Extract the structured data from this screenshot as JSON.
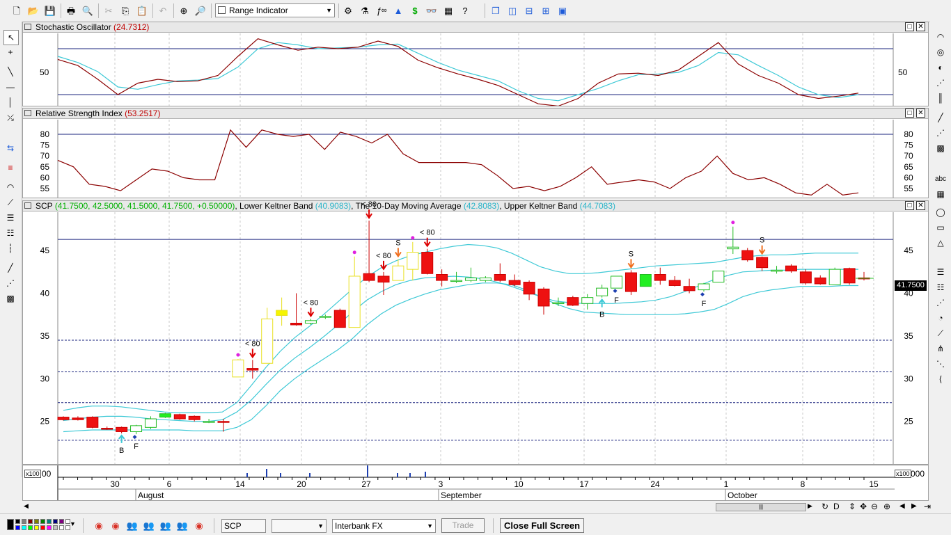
{
  "toolbar": {
    "indicator_select": "Range Indicator",
    "icons": [
      "new-file",
      "open-folder",
      "save",
      "print",
      "print-preview",
      "cut",
      "copy",
      "paste",
      "undo",
      "crosshair",
      "zoom",
      "object-properties",
      "indicator-builder",
      "formula",
      "trend",
      "dollar",
      "binoculars",
      "chart-properties",
      "help",
      "cascade",
      "tile-vertical",
      "tile-horizontal",
      "tile-grid",
      "screenshot"
    ]
  },
  "panels": {
    "stochastic": {
      "title": "Stochastic Oscillator",
      "value": "(24.7312)",
      "ticks": [
        "50"
      ]
    },
    "rsi": {
      "title": "Relative Strength Index",
      "value": "(53.2517)",
      "ticks": [
        "80",
        "75",
        "70",
        "65",
        "60",
        "55"
      ]
    },
    "price": {
      "symbol": "SCP",
      "quote": "(41.7500, 42.5000, 41.5000, 41.7500, +0.50000)",
      "lower_label": "Lower Keltner Band",
      "lower_value": "(40.9083)",
      "ma_label": "The 10-Day Moving Average",
      "ma_value": "(42.8083)",
      "upper_label": "Upper Keltner Band",
      "upper_value": "(44.7083)",
      "ticks": [
        "45",
        "40",
        "35",
        "30",
        "25"
      ],
      "last_price": "41.7500"
    }
  },
  "volume": {
    "multiplier": "x100",
    "zero": "00",
    "zero_right": "000"
  },
  "xaxis": {
    "day_labels": [
      "30",
      "6",
      "14",
      "20",
      "27",
      "3",
      "10",
      "17",
      "24",
      "1",
      "8",
      "15"
    ],
    "month_labels": [
      "August",
      "September",
      "October"
    ]
  },
  "signals": {
    "lt80": "< 80",
    "sell": "S",
    "buy": "B",
    "flat": "F"
  },
  "statusbar": {
    "symbol_input": "SCP",
    "period_select": "",
    "feed_select": "Interbank FX",
    "trade_button": "Trade",
    "fullscreen_button": "Close Full Screen"
  },
  "chart_data": [
    {
      "type": "line",
      "title": "Stochastic Oscillator",
      "ylim": [
        0,
        100
      ],
      "reference_lines": [
        80,
        20
      ],
      "series": [
        {
          "name": "%K",
          "color": "#8b0000",
          "values": [
            66,
            58,
            40,
            20,
            35,
            40,
            37,
            38,
            45,
            70,
            93,
            85,
            78,
            82,
            80,
            82,
            90,
            83,
            65,
            55,
            47,
            40,
            32,
            20,
            8,
            5,
            15,
            35,
            47,
            48,
            45,
            52,
            70,
            88,
            60,
            45,
            35,
            20,
            15,
            18,
            22
          ]
        },
        {
          "name": "%D",
          "color": "#3ec9d6",
          "values": [
            70,
            62,
            50,
            30,
            27,
            33,
            38,
            39,
            41,
            56,
            80,
            88,
            85,
            80,
            81,
            82,
            85,
            86,
            74,
            62,
            52,
            45,
            38,
            25,
            15,
            12,
            20,
            28,
            38,
            46,
            47,
            49,
            58,
            75,
            72,
            58,
            45,
            30,
            20,
            16,
            20
          ]
        }
      ]
    },
    {
      "type": "line",
      "title": "Relative Strength Index",
      "ylim": [
        50,
        85
      ],
      "reference_lines": [
        80,
        50
      ],
      "series": [
        {
          "name": "RSI",
          "color": "#8b0000",
          "values": [
            68,
            65,
            57,
            56,
            54,
            59,
            64,
            63,
            60,
            59,
            59,
            82,
            74,
            82,
            80,
            79,
            80,
            73,
            81,
            79,
            76,
            80,
            71,
            67,
            67,
            67,
            67,
            66,
            61,
            55,
            56,
            54,
            56,
            60,
            65,
            57,
            58,
            59,
            58,
            55,
            60,
            63,
            70,
            62,
            59,
            60,
            57,
            53,
            52,
            57,
            52,
            53
          ]
        }
      ]
    },
    {
      "type": "bar",
      "title": "SCP",
      "ylim": [
        22,
        49
      ],
      "reference_lines": [
        46.3,
        34.5,
        30.8,
        27.2,
        22.8
      ],
      "x": [
        "2018-07-26",
        "2018-07-27",
        "2018-07-30",
        "2018-07-31",
        "2018-08-01",
        "2018-08-02",
        "2018-08-03",
        "2018-08-06",
        "2018-08-07",
        "2018-08-08",
        "2018-08-09",
        "2018-08-10",
        "2018-08-13",
        "2018-08-14",
        "2018-08-15",
        "2018-08-16",
        "2018-08-17",
        "2018-08-20",
        "2018-08-21",
        "2018-08-22",
        "2018-08-23",
        "2018-08-24",
        "2018-08-27",
        "2018-08-28",
        "2018-08-29",
        "2018-08-30",
        "2018-08-31",
        "2018-09-03",
        "2018-09-04",
        "2018-09-05",
        "2018-09-06",
        "2018-09-07",
        "2018-09-10",
        "2018-09-11",
        "2018-09-12",
        "2018-09-13",
        "2018-09-14",
        "2018-09-17",
        "2018-09-18",
        "2018-09-19",
        "2018-09-20",
        "2018-09-21",
        "2018-09-24",
        "2018-09-25",
        "2018-09-26",
        "2018-09-27",
        "2018-09-28",
        "2018-10-01",
        "2018-10-02",
        "2018-10-03",
        "2018-10-04",
        "2018-10-05",
        "2018-10-08",
        "2018-10-09",
        "2018-10-10",
        "2018-10-11"
      ],
      "series": [
        {
          "name": "candles",
          "ohlc": [
            [
              25.5,
              25.6,
              25.1,
              25.2
            ],
            [
              25.4,
              25.6,
              25.1,
              25.2
            ],
            [
              25.5,
              25.6,
              24.2,
              24.3
            ],
            [
              24.2,
              24.4,
              24.0,
              24.1
            ],
            [
              24.3,
              24.4,
              23.6,
              23.8
            ],
            [
              23.8,
              24.6,
              23.5,
              24.5
            ],
            [
              24.3,
              25.6,
              24.1,
              25.3
            ],
            [
              25.5,
              26.0,
              25.4,
              25.9
            ],
            [
              25.8,
              25.9,
              25.2,
              25.3
            ],
            [
              25.6,
              25.7,
              25.0,
              25.2
            ],
            [
              25.0,
              25.3,
              24.8,
              25.0
            ],
            [
              25.0,
              25.3,
              23.8,
              24.9
            ],
            [
              30.2,
              32.3,
              30.2,
              32.2
            ],
            [
              31.2,
              32.2,
              30.0,
              31.0
            ],
            [
              31.8,
              38.3,
              31.8,
              37.0
            ],
            [
              37.4,
              39.5,
              36.2,
              38.0
            ],
            [
              36.5,
              40.0,
              36.2,
              36.3
            ],
            [
              36.5,
              37.0,
              36.3,
              36.8
            ],
            [
              37.2,
              37.5,
              37.0,
              37.3
            ],
            [
              38.0,
              38.2,
              36.0,
              36.0
            ],
            [
              36.0,
              44.3,
              36.0,
              42.0
            ],
            [
              42.3,
              48.5,
              41.3,
              41.5
            ],
            [
              42.0,
              42.5,
              39.8,
              41.3
            ],
            [
              41.5,
              44.0,
              41.5,
              43.2
            ],
            [
              42.8,
              46.0,
              41.5,
              44.8
            ],
            [
              44.8,
              45.2,
              42.2,
              42.3
            ],
            [
              42.2,
              42.8,
              40.8,
              41.5
            ],
            [
              41.5,
              42.5,
              41.2,
              41.5
            ],
            [
              41.5,
              43.0,
              41.3,
              41.8
            ],
            [
              41.5,
              42.0,
              41.3,
              41.8
            ],
            [
              42.2,
              43.5,
              41.3,
              41.5
            ],
            [
              41.5,
              42.2,
              40.8,
              41.0
            ],
            [
              41.3,
              41.5,
              39.2,
              39.9
            ],
            [
              40.5,
              40.7,
              37.5,
              38.5
            ],
            [
              38.9,
              39.5,
              38.5,
              38.9
            ],
            [
              39.5,
              39.7,
              38.5,
              38.6
            ],
            [
              38.8,
              39.9,
              38.1,
              39.5
            ],
            [
              39.7,
              41.0,
              39.5,
              40.6
            ],
            [
              40.6,
              42.0,
              40.6,
              42.0
            ],
            [
              42.4,
              42.7,
              39.8,
              40.2
            ],
            [
              40.8,
              42.2,
              40.8,
              42.2
            ],
            [
              42.2,
              43.0,
              41.0,
              41.5
            ],
            [
              41.5,
              42.0,
              40.8,
              40.9
            ],
            [
              40.8,
              41.7,
              40.0,
              40.3
            ],
            [
              40.4,
              41.2,
              40.2,
              41.1
            ],
            [
              41.3,
              42.6,
              41.3,
              42.6
            ],
            [
              45.2,
              47.8,
              44.6,
              45.4
            ],
            [
              45.0,
              45.3,
              43.7,
              43.9
            ],
            [
              44.2,
              44.3,
              42.6,
              43.0
            ],
            [
              42.7,
              43.2,
              42.3,
              42.7
            ],
            [
              43.2,
              43.4,
              42.4,
              42.6
            ],
            [
              42.5,
              42.8,
              41.0,
              41.2
            ],
            [
              41.8,
              42.1,
              41.0,
              41.1
            ],
            [
              41.0,
              43.0,
              41.0,
              42.8
            ],
            [
              42.9,
              43.0,
              41.0,
              41.2
            ],
            [
              41.8,
              42.5,
              41.5,
              41.7
            ]
          ]
        },
        {
          "name": "Lower Keltner Band",
          "color": "#3ec9d6",
          "values": [
            23.8,
            23.9,
            24.0,
            24.0,
            24.0,
            24.0,
            24.0,
            24.0,
            24.0,
            23.9,
            23.9,
            23.9,
            24.3,
            25.2,
            26.8,
            28.6,
            30.0,
            31.2,
            32.3,
            33.4,
            34.7,
            36.3,
            37.6,
            38.6,
            39.3,
            39.9,
            40.4,
            40.7,
            41.0,
            41.2,
            41.2,
            41.0,
            40.4,
            39.6,
            38.8,
            38.2,
            37.8,
            37.7,
            37.6,
            37.5,
            37.5,
            37.5,
            37.5,
            37.6,
            37.8,
            38.1,
            38.8,
            39.6,
            40.1,
            40.4,
            40.6,
            40.8,
            40.8,
            40.8,
            40.9,
            40.9
          ]
        },
        {
          "name": "The 10-Day Moving Average",
          "color": "#3ec9d6",
          "values": [
            25.1,
            25.3,
            25.5,
            25.6,
            25.6,
            25.5,
            25.3,
            25.2,
            25.1,
            25.0,
            25.0,
            25.2,
            26.1,
            27.5,
            29.3,
            31.0,
            32.4,
            33.6,
            34.9,
            36.3,
            37.8,
            39.2,
            40.2,
            41.0,
            41.5,
            41.8,
            41.9,
            42.0,
            41.9,
            41.7,
            41.3,
            40.8,
            40.2,
            39.6,
            39.1,
            38.9,
            38.8,
            38.8,
            38.8,
            38.9,
            39.0,
            39.2,
            39.6,
            40.2,
            40.9,
            41.6,
            42.1,
            42.5,
            42.6,
            42.7,
            42.7,
            42.8,
            42.8,
            42.8,
            42.8,
            42.8
          ]
        },
        {
          "name": "Upper Keltner Band",
          "color": "#3ec9d6",
          "values": [
            26.3,
            26.6,
            26.8,
            26.8,
            26.7,
            26.5,
            26.3,
            26.1,
            26.0,
            26.0,
            26.0,
            26.1,
            27.2,
            29.2,
            31.3,
            33.2,
            34.8,
            36.1,
            37.5,
            39.0,
            40.5,
            41.9,
            43.0,
            43.8,
            44.4,
            44.8,
            45.2,
            45.5,
            45.7,
            45.6,
            45.3,
            44.7,
            43.9,
            43.1,
            42.6,
            42.3,
            42.3,
            42.4,
            42.6,
            42.8,
            43.0,
            43.2,
            43.3,
            43.4,
            43.5,
            43.6,
            43.9,
            44.2,
            44.4,
            44.5,
            44.5,
            44.6,
            44.7,
            44.7,
            44.7,
            44.7
          ]
        }
      ]
    }
  ]
}
